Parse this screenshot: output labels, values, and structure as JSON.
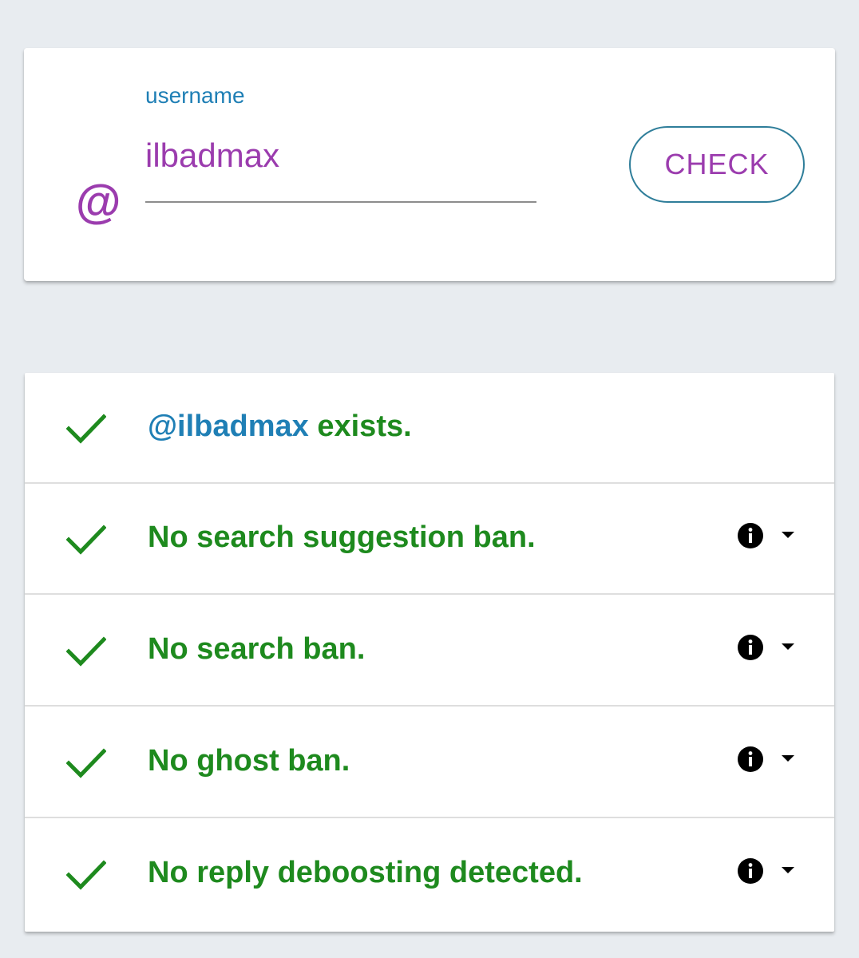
{
  "search": {
    "at_symbol": "@",
    "label": "username",
    "value": "ilbadmax",
    "button_label": "CHECK"
  },
  "results": [
    {
      "handle": "@ilbadmax",
      "text": " exists.",
      "has_info": false,
      "status": "ok"
    },
    {
      "handle": "",
      "text": "No search suggestion ban.",
      "has_info": true,
      "status": "ok"
    },
    {
      "handle": "",
      "text": "No search ban.",
      "has_info": true,
      "status": "ok"
    },
    {
      "handle": "",
      "text": "No ghost ban.",
      "has_info": true,
      "status": "ok"
    },
    {
      "handle": "",
      "text": "No reply deboosting detected.",
      "has_info": true,
      "status": "ok"
    }
  ],
  "colors": {
    "background": "#e8ecf0",
    "accent_purple": "#9b3cae",
    "accent_blue": "#1f7fb5",
    "success_green": "#1e8a1e",
    "button_border": "#2f7e9a"
  },
  "icons": {
    "status_ok": "checkmark-icon",
    "info": "info-icon",
    "expand": "dropdown-arrow-icon"
  }
}
